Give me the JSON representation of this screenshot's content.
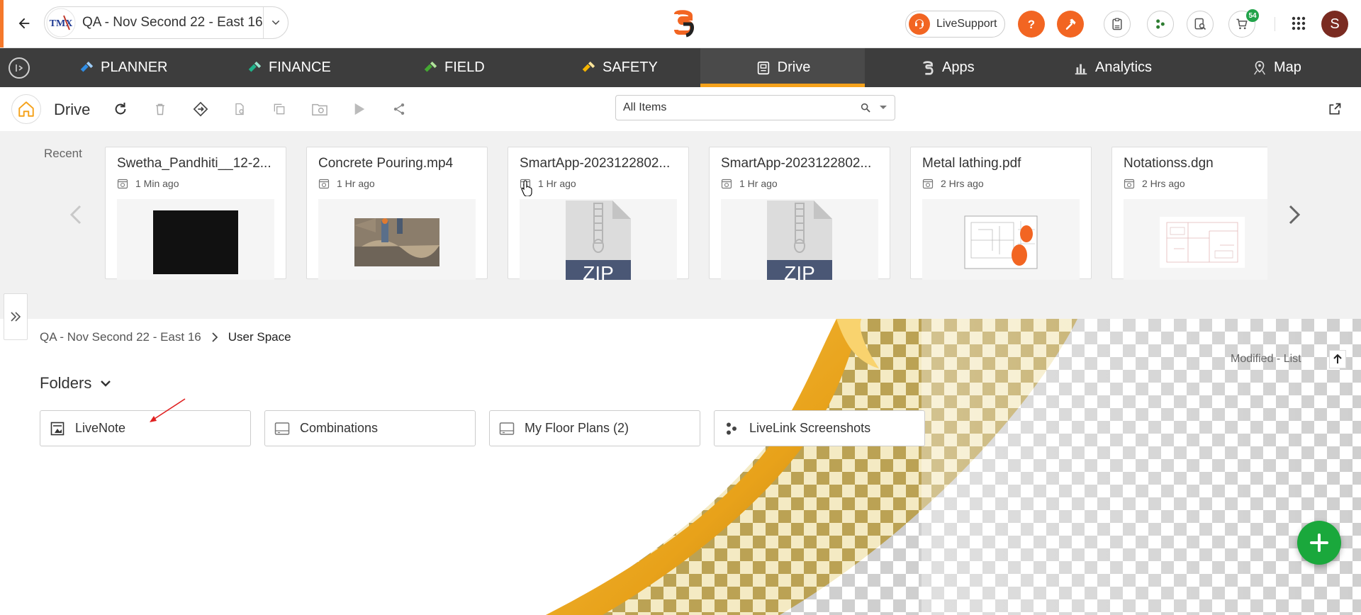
{
  "header": {
    "project_name": "QA - Nov Second 22 - East 16",
    "project_logo_text": "TMX",
    "livesupport_label": "LiveSupport",
    "notification_count": "54",
    "avatar_initial": "S"
  },
  "nav": {
    "items": [
      {
        "label": "PLANNER",
        "icon": "planner-icon"
      },
      {
        "label": "FINANCE",
        "icon": "finance-icon"
      },
      {
        "label": "FIELD",
        "icon": "field-icon"
      },
      {
        "label": "SAFETY",
        "icon": "safety-icon"
      },
      {
        "label": "Drive",
        "icon": "drive-icon",
        "active": true
      },
      {
        "label": "Apps",
        "icon": "apps-icon"
      },
      {
        "label": "Analytics",
        "icon": "analytics-icon"
      },
      {
        "label": "Map",
        "icon": "map-pin-icon"
      }
    ],
    "active_color": "#f5a21b"
  },
  "toolbar": {
    "title": "Drive",
    "filter_value": "All Items"
  },
  "recent": {
    "label": "Recent",
    "cards": [
      {
        "title": "Swetha_Pandhiti__12-2...",
        "time": "1 Min ago",
        "thumb": "black-video"
      },
      {
        "title": "Concrete Pouring.mp4",
        "time": "1 Hr ago",
        "thumb": "photo"
      },
      {
        "title": "SmartApp-2023122802...",
        "time": "1 Hr ago",
        "thumb": "zip",
        "thumb_text": "ZIP"
      },
      {
        "title": "SmartApp-2023122802...",
        "time": "1 Hr ago",
        "thumb": "zip",
        "thumb_text": "ZIP"
      },
      {
        "title": "Metal lathing.pdf",
        "time": "2 Hrs ago",
        "thumb": "drawing"
      },
      {
        "title": "Notationss.dgn",
        "time": "2 Hrs ago",
        "thumb": "plan"
      }
    ]
  },
  "breadcrumb": {
    "root": "QA - Nov Second 22 - East 16",
    "current": "User Space"
  },
  "sort": {
    "label": "Modified - List"
  },
  "folders": {
    "heading": "Folders",
    "items": [
      {
        "label": "LiveNote",
        "icon": "livenote-icon"
      },
      {
        "label": "Combinations",
        "icon": "tray-icon"
      },
      {
        "label": "My Floor Plans (2)",
        "icon": "tray-icon"
      },
      {
        "label": "LiveLink Screenshots",
        "icon": "livelink-icon"
      }
    ]
  },
  "colors": {
    "accent_orange": "#f26522",
    "nav_bg": "#3d3d3d",
    "fab_green": "#1aa83c"
  }
}
